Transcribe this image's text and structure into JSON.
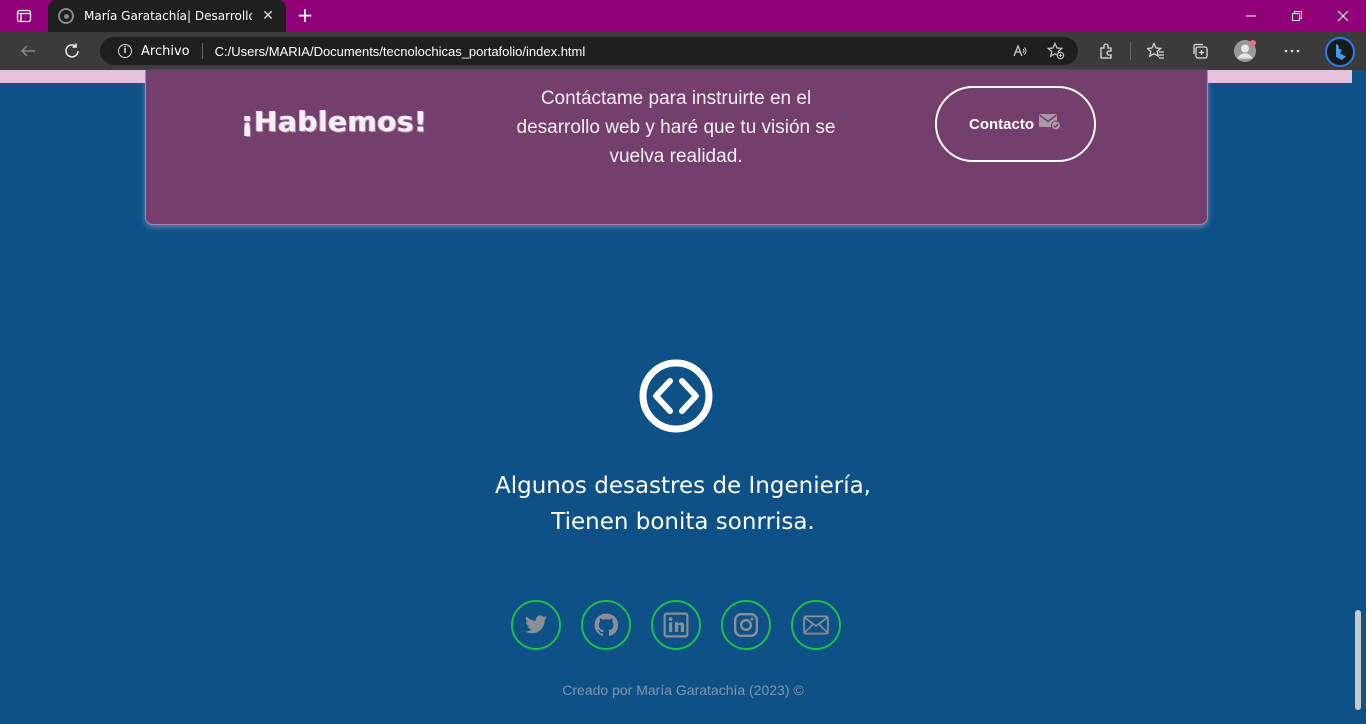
{
  "browser": {
    "tab": {
      "title": "María Garatachía| Desarrollo Web",
      "close": "✕"
    },
    "new_tab": "+",
    "window_controls": {
      "minimize": "minimize-icon",
      "restore": "restore-icon",
      "close": "close-icon"
    },
    "address": {
      "scheme": "Archivo",
      "url": "C:/Users/MARIA/Documents/tecnolochicas_portafolio/index.html"
    },
    "toolbar_icons": [
      "back-icon",
      "refresh-icon",
      "read-aloud-icon",
      "add-favorite-icon",
      "extensions-icon",
      "favorites-icon",
      "collections-icon",
      "profile-icon",
      "more-icon",
      "bing-icon"
    ]
  },
  "cta": {
    "title": "¡Hablemos!",
    "text": "Contáctame para instruirte en el desarrollo web y haré que tu visión se vuelva realidad.",
    "button_label": "Contacto"
  },
  "footer": {
    "tagline_line1": "Algunos desastres de Ingeniería,",
    "tagline_line2": "Tienen bonita sonrrisa.",
    "social": [
      "twitter-icon",
      "github-icon",
      "linkedin-icon",
      "instagram-icon",
      "email-icon"
    ],
    "credits": "Creado por María Garatachía (2023) ©"
  },
  "colors": {
    "page_background": "#0e5186",
    "card_background": "#743f6c",
    "titlebar": "#900179",
    "social_ring": "#1ebd4f",
    "icon_gray": "#8a8f96"
  }
}
